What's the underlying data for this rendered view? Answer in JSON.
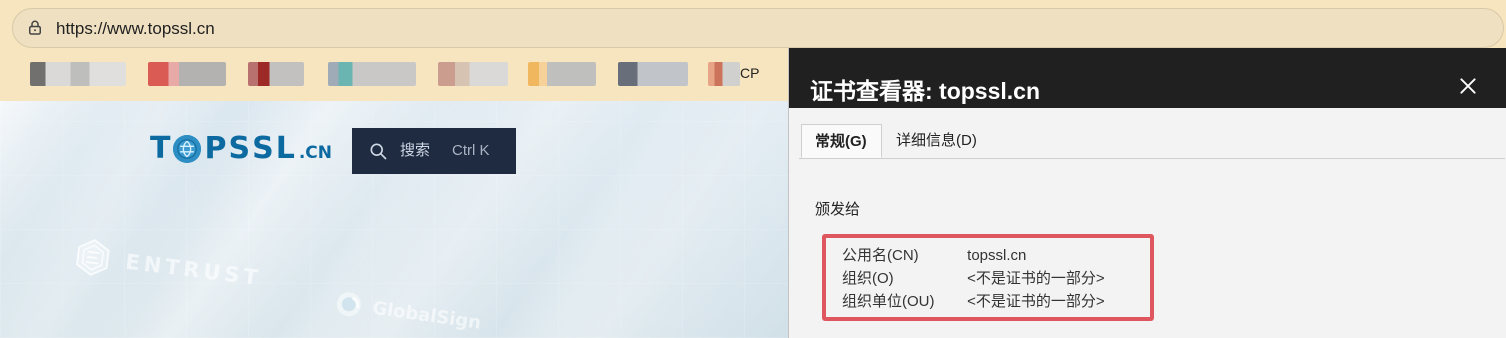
{
  "browser": {
    "url": "https://www.topssl.cn",
    "cp_label": "CP"
  },
  "website": {
    "logo": {
      "main": "TOPSSL",
      "suffix": ".CN"
    },
    "search": {
      "label": "搜索",
      "shortcut": "Ctrl K"
    },
    "brands": [
      "ENTRUST",
      "GlobalSign"
    ]
  },
  "certificate_viewer": {
    "title": "证书查看器: topssl.cn",
    "tabs": [
      {
        "label": "常规(G)",
        "active": true
      },
      {
        "label": "详细信息(D)",
        "active": false
      }
    ],
    "section_title": "颁发给",
    "fields": [
      {
        "label": "公用名(CN)",
        "value": "topssl.cn"
      },
      {
        "label": "组织(O)",
        "value": "<不是证书的一部分>"
      },
      {
        "label": "组织单位(OU)",
        "value": "<不是证书的一部分>"
      }
    ]
  },
  "icons": {
    "lock": "lock-icon",
    "search": "search-icon",
    "close": "close-icon",
    "entrust": "entrust-icon",
    "globalsign": "globalsign-icon"
  },
  "colors": {
    "browser_bar": "#f6e5bf",
    "search_bg": "#1e2b40",
    "viewer_header": "#202020",
    "highlight_red": "#e0565f",
    "logo_blue": "#0c6aa1"
  }
}
